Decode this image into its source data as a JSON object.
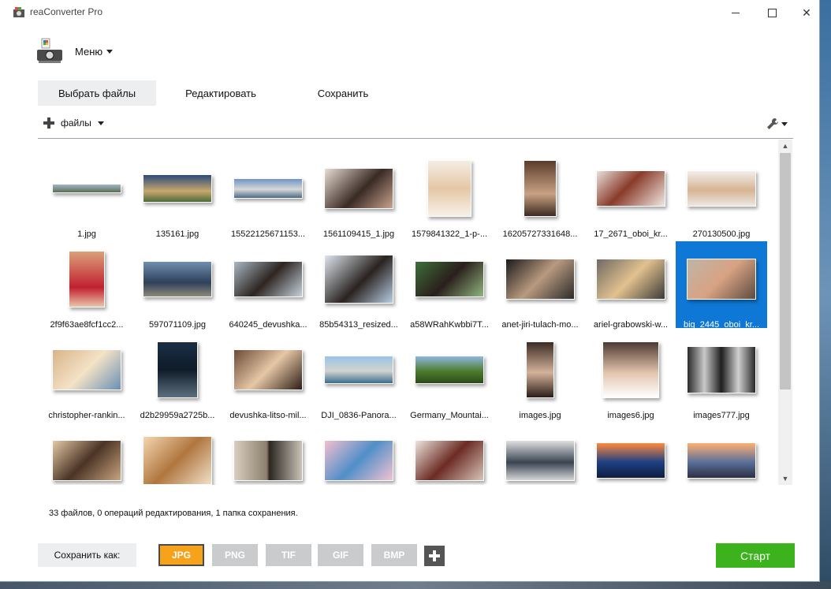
{
  "window": {
    "title": "reaConverter Pro"
  },
  "menu": {
    "label": "Меню"
  },
  "tabs": [
    {
      "label": "Выбрать файлы"
    },
    {
      "label": "Редактировать"
    },
    {
      "label": "Сохранить"
    }
  ],
  "toolbar": {
    "add_files_label": "файлы"
  },
  "files": [
    {
      "name": "1.jpg"
    },
    {
      "name": "135161.jpg"
    },
    {
      "name": "15522125671153..."
    },
    {
      "name": "1561109415_1.jpg"
    },
    {
      "name": "1579841322_1-p-..."
    },
    {
      "name": "16205727331648..."
    },
    {
      "name": "17_2671_oboi_kr..."
    },
    {
      "name": "270130500.jpg"
    },
    {
      "name": "2f9f63ae8fcf1cc2..."
    },
    {
      "name": "597071109.jpg"
    },
    {
      "name": "640245_devushka..."
    },
    {
      "name": "85b54313_resized..."
    },
    {
      "name": "a58WRahKwbbi7T..."
    },
    {
      "name": "anet-jiri-tulach-mo..."
    },
    {
      "name": "ariel-grabowski-w..."
    },
    {
      "name": "big_2445_oboi_kr...",
      "selected": true
    },
    {
      "name": "christopher-rankin..."
    },
    {
      "name": "d2b29959a2725b..."
    },
    {
      "name": "devushka-litso-mil..."
    },
    {
      "name": "DJI_0836-Panora..."
    },
    {
      "name": "Germany_Mountai..."
    },
    {
      "name": "images.jpg"
    },
    {
      "name": "images6.jpg"
    },
    {
      "name": "images777.jpg"
    },
    {
      "name": ""
    },
    {
      "name": ""
    },
    {
      "name": ""
    },
    {
      "name": ""
    },
    {
      "name": ""
    },
    {
      "name": ""
    },
    {
      "name": ""
    },
    {
      "name": ""
    }
  ],
  "status": {
    "text": "33 файлов, 0 операций редактирования, 1 папка сохранения."
  },
  "save_as": {
    "label": "Сохранить как:"
  },
  "formats": [
    {
      "label": "JPG",
      "active": true
    },
    {
      "label": "PNG"
    },
    {
      "label": "TIF"
    },
    {
      "label": "GIF"
    },
    {
      "label": "BMP"
    }
  ],
  "start": {
    "label": "Старт"
  },
  "colors": {
    "accent_selected": "#0f78d7",
    "start_green": "#3cb21c",
    "format_active": "#f7a21b"
  }
}
